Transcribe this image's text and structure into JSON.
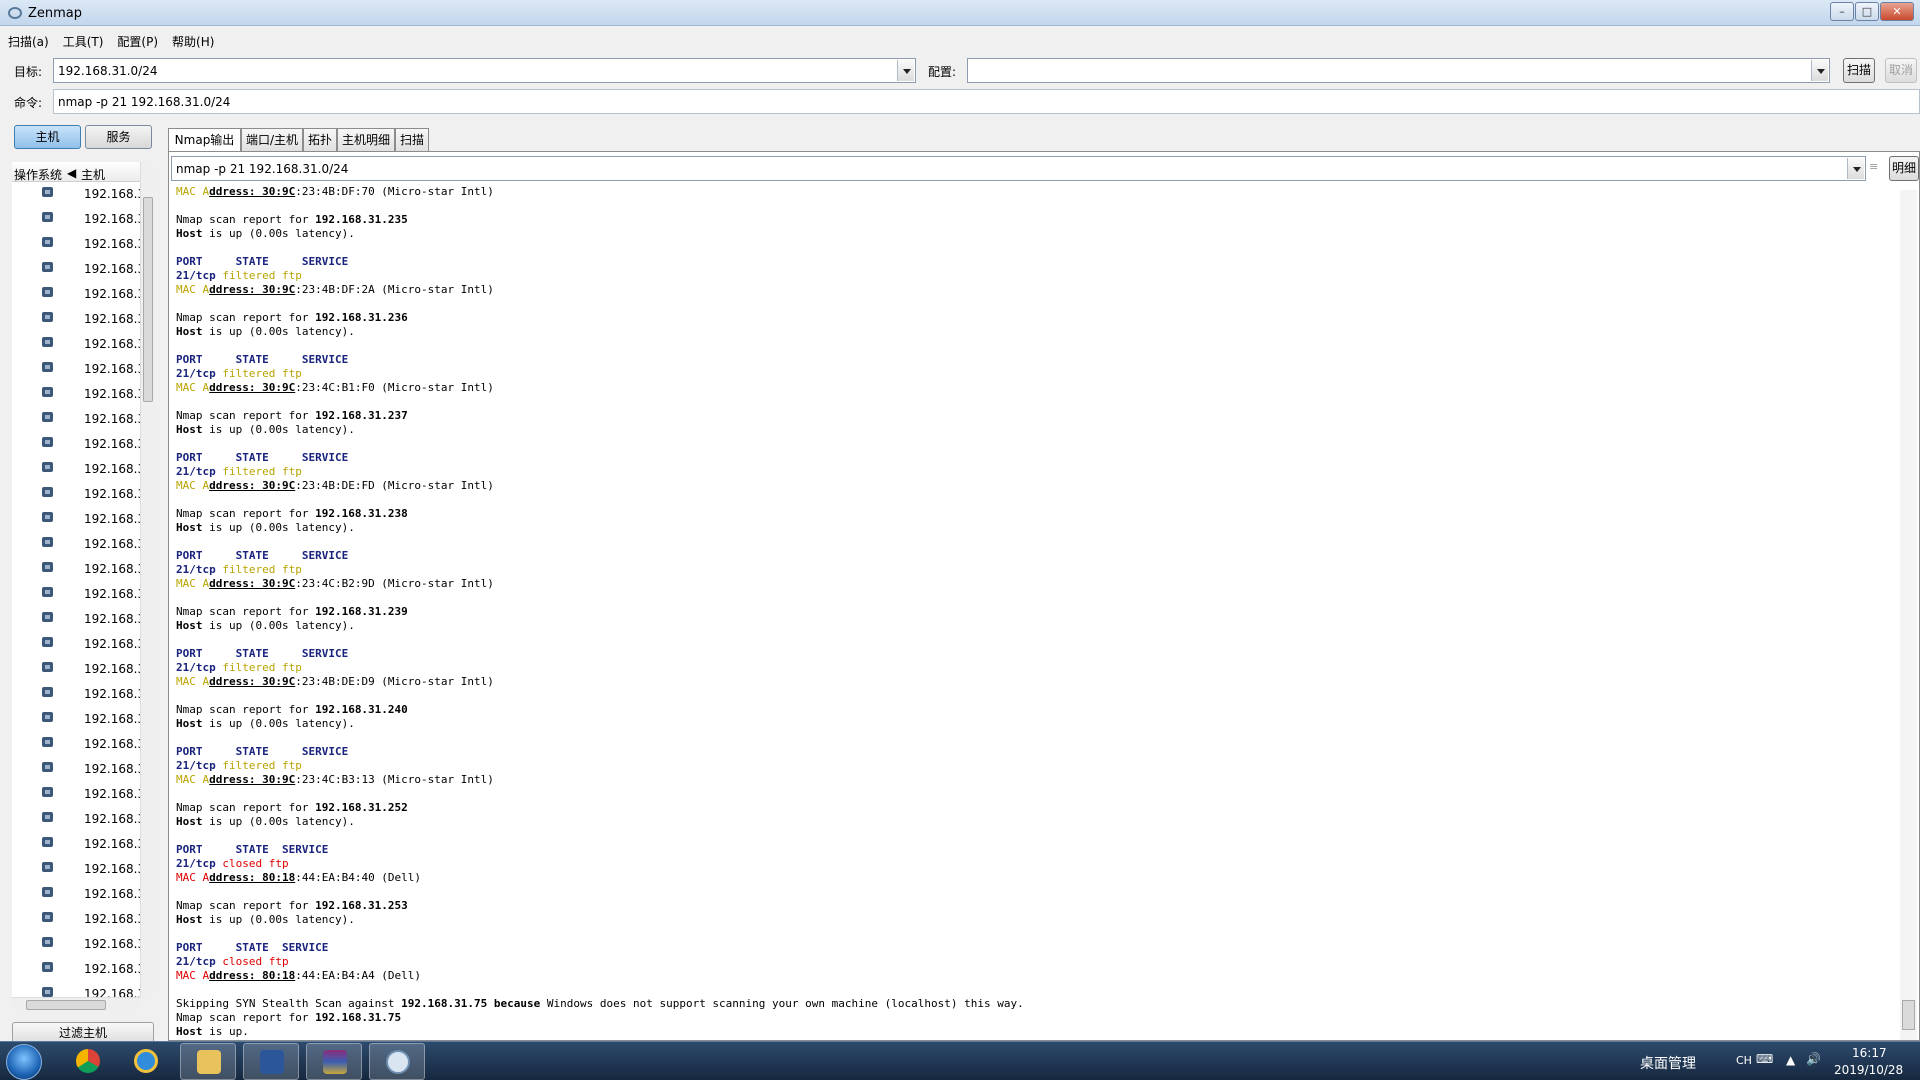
{
  "window": {
    "title": "Zenmap"
  },
  "menu": [
    "扫描(a)",
    "工具(T)",
    "配置(P)",
    "帮助(H)"
  ],
  "toolbar": {
    "target_label": "目标:",
    "target_value": "192.168.31.0/24",
    "profile_label": "配置:",
    "profile_value": "",
    "scan_button": "扫描",
    "cancel_button": "取消",
    "command_label": "命令:",
    "command_value": "nmap -p 21 192.168.31.0/24"
  },
  "left_panel": {
    "hosts_button": "主机",
    "services_button": "服务",
    "col_os": "操作系统",
    "col_host": "主机",
    "hosts": [
      "192.168.3",
      "192.168.3",
      "192.168.3",
      "192.168.3",
      "192.168.3",
      "192.168.3",
      "192.168.3",
      "192.168.3",
      "192.168.3",
      "192.168.3",
      "192.168.3",
      "192.168.3",
      "192.168.3",
      "192.168.3",
      "192.168.3",
      "192.168.3",
      "192.168.3",
      "192.168.3",
      "192.168.3",
      "192.168.3",
      "192.168.3",
      "192.168.3",
      "192.168.3",
      "192.168.3",
      "192.168.3",
      "192.168.3",
      "192.168.3",
      "192.168.3",
      "192.168.3",
      "192.168.3",
      "192.168.3",
      "192.168.3",
      "192.168.3"
    ],
    "filter_button": "过滤主机"
  },
  "tabs": [
    "Nmap输出",
    "端口/主机",
    "拓扑",
    "主机明细",
    "扫描"
  ],
  "output": {
    "command_select": "nmap -p 21 192.168.31.0/24",
    "details_button": "明细",
    "lines": [
      [
        {
          "t": "MAC A",
          "c": "mac"
        },
        {
          "t": "ddress: 30:9C",
          "c": "ul"
        },
        {
          "t": ":23:4B:DF:70 (Micro-star Intl)"
        }
      ],
      [],
      [
        {
          "t": "Nmap scan report for "
        },
        {
          "t": "192.168.31.235",
          "c": "bold"
        }
      ],
      [
        {
          "t": "Host",
          "c": "bold"
        },
        {
          "t": " is up (0.00s latency)."
        }
      ],
      [],
      [
        {
          "t": "PORT     STATE     SERVICE",
          "c": "hdr"
        }
      ],
      [
        {
          "t": "21/tcp",
          "c": "port"
        },
        {
          "t": " filtered ftp",
          "c": "st-filt"
        }
      ],
      [
        {
          "t": "MAC A",
          "c": "mac"
        },
        {
          "t": "ddress: 30:9C",
          "c": "ul"
        },
        {
          "t": ":23:4B:DF:2A (Micro-star Intl)"
        }
      ],
      [],
      [
        {
          "t": "Nmap scan report for "
        },
        {
          "t": "192.168.31.236",
          "c": "bold"
        }
      ],
      [
        {
          "t": "Host",
          "c": "bold"
        },
        {
          "t": " is up (0.00s latency)."
        }
      ],
      [],
      [
        {
          "t": "PORT     STATE     SERVICE",
          "c": "hdr"
        }
      ],
      [
        {
          "t": "21/tcp",
          "c": "port"
        },
        {
          "t": " filtered ftp",
          "c": "st-filt"
        }
      ],
      [
        {
          "t": "MAC A",
          "c": "mac"
        },
        {
          "t": "ddress: 30:9C",
          "c": "ul"
        },
        {
          "t": ":23:4C:B1:F0 (Micro-star Intl)"
        }
      ],
      [],
      [
        {
          "t": "Nmap scan report for "
        },
        {
          "t": "192.168.31.237",
          "c": "bold"
        }
      ],
      [
        {
          "t": "Host",
          "c": "bold"
        },
        {
          "t": " is up (0.00s latency)."
        }
      ],
      [],
      [
        {
          "t": "PORT     STATE     SERVICE",
          "c": "hdr"
        }
      ],
      [
        {
          "t": "21/tcp",
          "c": "port"
        },
        {
          "t": " filtered ftp",
          "c": "st-filt"
        }
      ],
      [
        {
          "t": "MAC A",
          "c": "mac"
        },
        {
          "t": "ddress: 30:9C",
          "c": "ul"
        },
        {
          "t": ":23:4B:DE:FD (Micro-star Intl)"
        }
      ],
      [],
      [
        {
          "t": "Nmap scan report for "
        },
        {
          "t": "192.168.31.238",
          "c": "bold"
        }
      ],
      [
        {
          "t": "Host",
          "c": "bold"
        },
        {
          "t": " is up (0.00s latency)."
        }
      ],
      [],
      [
        {
          "t": "PORT     STATE     SERVICE",
          "c": "hdr"
        }
      ],
      [
        {
          "t": "21/tcp",
          "c": "port"
        },
        {
          "t": " filtered ftp",
          "c": "st-filt"
        }
      ],
      [
        {
          "t": "MAC A",
          "c": "mac"
        },
        {
          "t": "ddress: 30:9C",
          "c": "ul"
        },
        {
          "t": ":23:4C:B2:9D (Micro-star Intl)"
        }
      ],
      [],
      [
        {
          "t": "Nmap scan report for "
        },
        {
          "t": "192.168.31.239",
          "c": "bold"
        }
      ],
      [
        {
          "t": "Host",
          "c": "bold"
        },
        {
          "t": " is up (0.00s latency)."
        }
      ],
      [],
      [
        {
          "t": "PORT     STATE     SERVICE",
          "c": "hdr"
        }
      ],
      [
        {
          "t": "21/tcp",
          "c": "port"
        },
        {
          "t": " filtered ftp",
          "c": "st-filt"
        }
      ],
      [
        {
          "t": "MAC A",
          "c": "mac"
        },
        {
          "t": "ddress: 30:9C",
          "c": "ul"
        },
        {
          "t": ":23:4B:DE:D9 (Micro-star Intl)"
        }
      ],
      [],
      [
        {
          "t": "Nmap scan report for "
        },
        {
          "t": "192.168.31.240",
          "c": "bold"
        }
      ],
      [
        {
          "t": "Host",
          "c": "bold"
        },
        {
          "t": " is up (0.00s latency)."
        }
      ],
      [],
      [
        {
          "t": "PORT     STATE     SERVICE",
          "c": "hdr"
        }
      ],
      [
        {
          "t": "21/tcp",
          "c": "port"
        },
        {
          "t": " filtered ftp",
          "c": "st-filt"
        }
      ],
      [
        {
          "t": "MAC A",
          "c": "mac"
        },
        {
          "t": "ddress: 30:9C",
          "c": "ul"
        },
        {
          "t": ":23:4C:B3:13 (Micro-star Intl)"
        }
      ],
      [],
      [
        {
          "t": "Nmap scan report for "
        },
        {
          "t": "192.168.31.252",
          "c": "bold"
        }
      ],
      [
        {
          "t": "Host",
          "c": "bold"
        },
        {
          "t": " is up (0.00s latency)."
        }
      ],
      [],
      [
        {
          "t": "PORT     STATE  SERVICE",
          "c": "hdr"
        }
      ],
      [
        {
          "t": "21/tcp",
          "c": "port"
        },
        {
          "t": " closed ftp",
          "c": "st-closed"
        }
      ],
      [
        {
          "t": "MAC A",
          "c": "mac-red"
        },
        {
          "t": "ddress: 80:18",
          "c": "ul"
        },
        {
          "t": ":44:EA:B4:40 (Dell)"
        }
      ],
      [],
      [
        {
          "t": "Nmap scan report for "
        },
        {
          "t": "192.168.31.253",
          "c": "bold"
        }
      ],
      [
        {
          "t": "Host",
          "c": "bold"
        },
        {
          "t": " is up (0.00s latency)."
        }
      ],
      [],
      [
        {
          "t": "PORT     STATE  SERVICE",
          "c": "hdr"
        }
      ],
      [
        {
          "t": "21/tcp",
          "c": "port"
        },
        {
          "t": " closed ftp",
          "c": "st-closed"
        }
      ],
      [
        {
          "t": "MAC A",
          "c": "mac-red"
        },
        {
          "t": "ddress: 80:18",
          "c": "ul"
        },
        {
          "t": ":44:EA:B4:A4 (Dell)"
        }
      ],
      [],
      [
        {
          "t": "Skipping SYN Stealth Scan against "
        },
        {
          "t": "192.168.31.75",
          "c": "bold"
        },
        {
          "t": " "
        },
        {
          "t": "because",
          "c": "bold"
        },
        {
          "t": " Windows does not support scanning your own machine (localhost) this way."
        }
      ],
      [
        {
          "t": "Nmap scan report for "
        },
        {
          "t": "192.168.31.75",
          "c": "bold"
        }
      ],
      [
        {
          "t": "Host",
          "c": "bold"
        },
        {
          "t": " is up."
        }
      ]
    ]
  },
  "taskbar": {
    "items": [
      "chrome-icon",
      "ie-icon",
      "explorer-icon",
      "word-icon",
      "winrar-icon",
      "zenmap-icon"
    ],
    "desktop_label": "桌面管理",
    "ime": "CH",
    "time": "16:17",
    "date": "2019/10/28"
  }
}
